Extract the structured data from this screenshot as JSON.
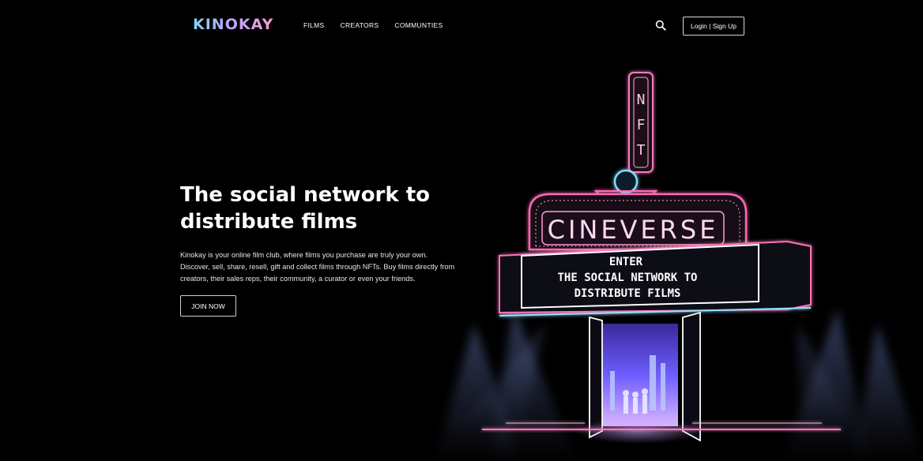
{
  "nav": {
    "logo": "KINOKAY",
    "links": [
      {
        "label": "FILMS"
      },
      {
        "label": "CREATORS"
      },
      {
        "label": "COMMUNTIES"
      }
    ],
    "search_icon": "search-icon",
    "login_label": "Login | Sign Up"
  },
  "hero": {
    "title_line1": "The social network to",
    "title_line2": "distribute films",
    "description": "Kinokay is your online film club, where films you purchase are truly your own. Discover, sell, share, resell, gift and collect films through NFTs. Buy films directly from creators, their sales reps, their community, a curator or even your friends.",
    "cta_label": "JOIN NOW"
  },
  "illustration": {
    "tower_letters": [
      "N",
      "F",
      "T"
    ],
    "marquee_title": "CINEVERSE",
    "sign_line1": "ENTER",
    "sign_line2": "THE SOCIAL NETWORK TO",
    "sign_line3": "DISTRIBUTE FILMS"
  },
  "colors": {
    "background": "#000000",
    "neon_pink": "#ff4fa8",
    "neon_blue": "#6fd6ff",
    "neon_purple": "#b07cff"
  }
}
